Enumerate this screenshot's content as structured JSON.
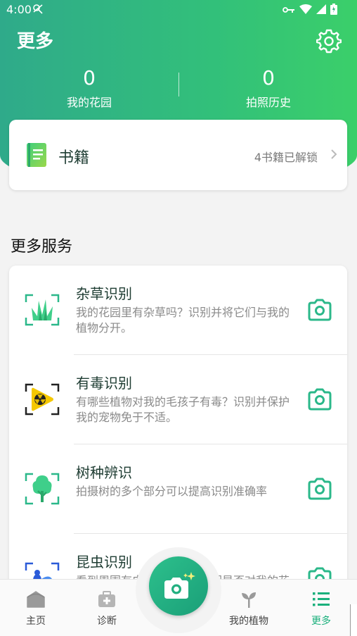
{
  "status_bar": {
    "time": "4:00"
  },
  "header": {
    "title": "更多",
    "stats": [
      {
        "value": "0",
        "label": "我的花园"
      },
      {
        "value": "0",
        "label": "拍照历史"
      }
    ]
  },
  "books": {
    "title": "书籍",
    "status": "4书籍已解锁"
  },
  "services": {
    "section_title": "更多服务",
    "items": [
      {
        "title": "杂草识别",
        "desc": "我的花园里有杂草吗？识别并将它们与我的植物分开。",
        "icon": "weed-icon"
      },
      {
        "title": "有毒识别",
        "desc": "有哪些植物对我的毛孩子有毒？识别并保护我的宠物免于不适。",
        "icon": "toxic-icon"
      },
      {
        "title": "树种辨识",
        "desc": "拍摄树的多个部分可以提高识别准确率",
        "icon": "tree-icon"
      },
      {
        "title": "昆虫识别",
        "desc": "看到周围有虫子吗？识别它们是否对我的花园",
        "icon": "insect-icon"
      }
    ]
  },
  "bottom_nav": {
    "items": [
      {
        "label": "主页",
        "icon": "home-icon"
      },
      {
        "label": "诊断",
        "icon": "diagnose-icon"
      },
      {
        "label": "我的植物",
        "icon": "plant-icon"
      },
      {
        "label": "更多",
        "icon": "list-icon"
      }
    ],
    "active": "更多"
  },
  "colors": {
    "accent": "#1ab07c",
    "header_start": "#2faa8a",
    "header_end": "#3bcf6a"
  }
}
